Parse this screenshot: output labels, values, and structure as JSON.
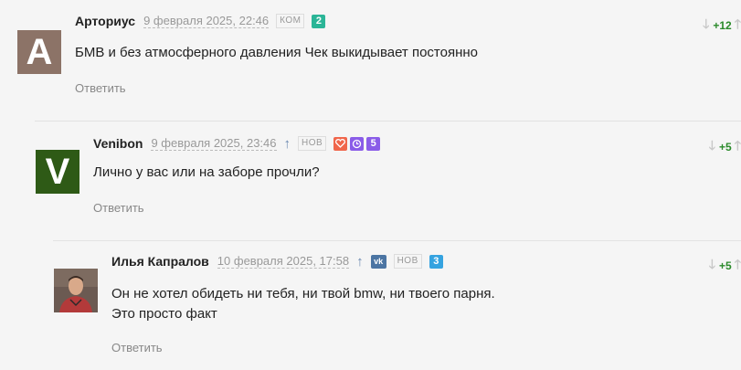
{
  "comments": [
    {
      "author": "Арториус",
      "avatar_letter": "A",
      "date": "9 февраля 2025, 22:46",
      "tag": "КОМ",
      "badges": [
        "2"
      ],
      "text_lines": [
        "БМВ и без атмосферного давления Чек выкидывает постоянно"
      ],
      "reply_label": "Ответить",
      "score": "+12"
    },
    {
      "author": "Venibon",
      "avatar_letter": "V",
      "date": "9 февраля 2025, 23:46",
      "tag": "НОВ",
      "badges": [
        "5"
      ],
      "text_lines": [
        "Лично у вас или на заборе прочли?"
      ],
      "reply_label": "Ответить",
      "score": "+5"
    },
    {
      "author": "Илья Капралов",
      "date": "10 февраля 2025, 17:58",
      "tag": "НОВ",
      "badges": [
        "3"
      ],
      "text_lines": [
        "Он не хотел обидеть ни тебя, ни твой bmw, ни твоего парня.",
        "Это просто факт"
      ],
      "reply_label": "Ответить",
      "score": "+5"
    }
  ],
  "colors": {
    "background": "#f5f5f5",
    "score_positive": "#2a8a2a",
    "badge_green": "#2bb597",
    "badge_purple": "#8a5ce8",
    "badge_blue": "#35a3e0"
  }
}
